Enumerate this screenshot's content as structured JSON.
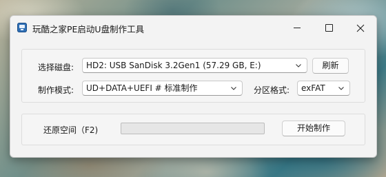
{
  "window": {
    "title": "玩酷之家PE启动U盘制作工具"
  },
  "disk": {
    "label": "选择磁盘:",
    "selected": "HD2: USB SanDisk 3.2Gen1 (57.29 GB, E:)",
    "refresh_label": "刷新"
  },
  "mode": {
    "label": "制作模式:",
    "selected": "UD+DATA+UEFI # 标准制作"
  },
  "partition": {
    "label": "分区格式:",
    "selected": "exFAT"
  },
  "action": {
    "restore_label": "还原空间（F2)",
    "progress": 0,
    "start_label": "开始制作"
  },
  "icons": {
    "app": "usb-drive-icon",
    "minimize": "minimize-icon",
    "maximize": "maximize-icon",
    "close": "close-icon",
    "dropdown": "chevron-down-icon"
  },
  "colors": {
    "progress_fill": "#06b025",
    "window_background": "#f3f3f3"
  }
}
